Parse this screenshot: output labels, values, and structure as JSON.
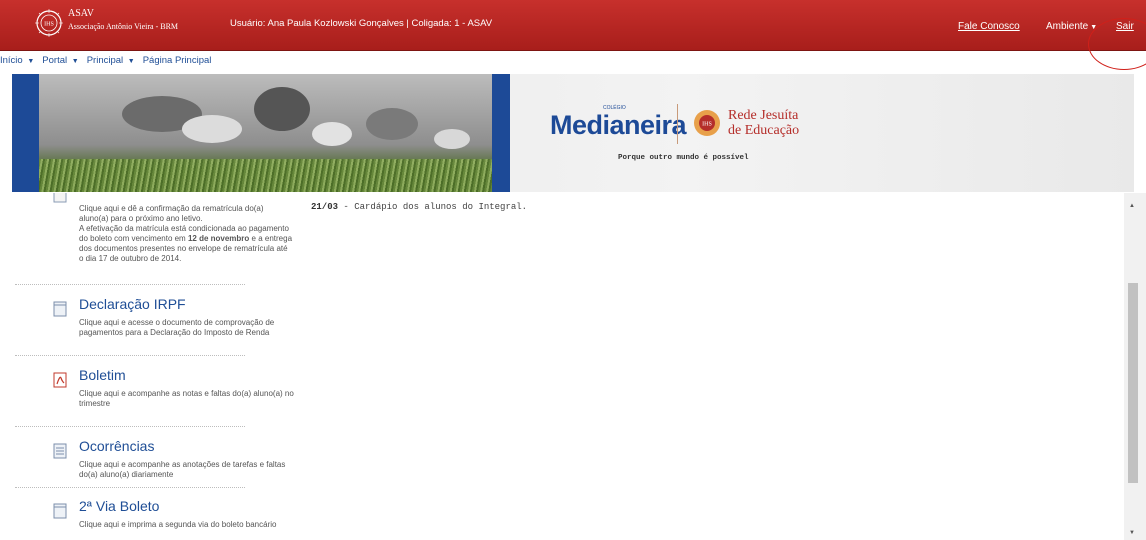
{
  "header": {
    "org_name": "ASAV",
    "org_sub": "Associação Antônio Vieira - BRM",
    "user_info": "Usuário: Ana Paula Kozlowski Gonçalves  |  Coligada: 1 - ASAV",
    "fale_conosco": "Fale Conosco",
    "ambiente": "Ambiente",
    "sair": "Sair",
    "accent_color": "#b82420"
  },
  "breadcrumb": [
    {
      "label": "Início"
    },
    {
      "label": "Portal"
    },
    {
      "label": "Principal"
    },
    {
      "label": "Página Principal"
    }
  ],
  "banner": {
    "logo_small": "COLÉGIO",
    "logo": "Medianeira",
    "rede_line1": "Rede Jesuíta",
    "rede_line2": "de Educação",
    "tagline": "Porque outro mundo é possível"
  },
  "items": [
    {
      "title": "",
      "desc_html": "Clique aqui e dê a confirmação da rematrícula do(a) aluno(a) para o próximo ano letivo.<br>A efetivação da matrícula está condicionada ao pagamento do boleto com vencimento em <b>12 de novembro</b> e a entrega dos documentos presentes no envelope de rematrícula até o dia 17 de outubro de 2014.",
      "icon": "document-icon"
    },
    {
      "title": "Declaração IRPF",
      "desc": "Clique aqui e acesse o documento de comprovação de pagamentos para a Declaração do Imposto de Renda",
      "icon": "document-icon"
    },
    {
      "title": "Boletim",
      "desc": "Clique aqui e acompanhe as notas e faltas do(a) aluno(a) no trimestre",
      "icon": "pdf-icon"
    },
    {
      "title": "Ocorrências",
      "desc": "Clique aqui e acompanhe as anotações de tarefas e faltas do(a) aluno(a) diariamente",
      "icon": "list-icon"
    },
    {
      "title": "2ª Via Boleto",
      "desc": "Clique aqui e imprima a segunda via do boleto bancário",
      "icon": "document-icon"
    }
  ],
  "news": {
    "date": "21/03",
    "text": " - Cardápio dos alunos do Integral."
  }
}
